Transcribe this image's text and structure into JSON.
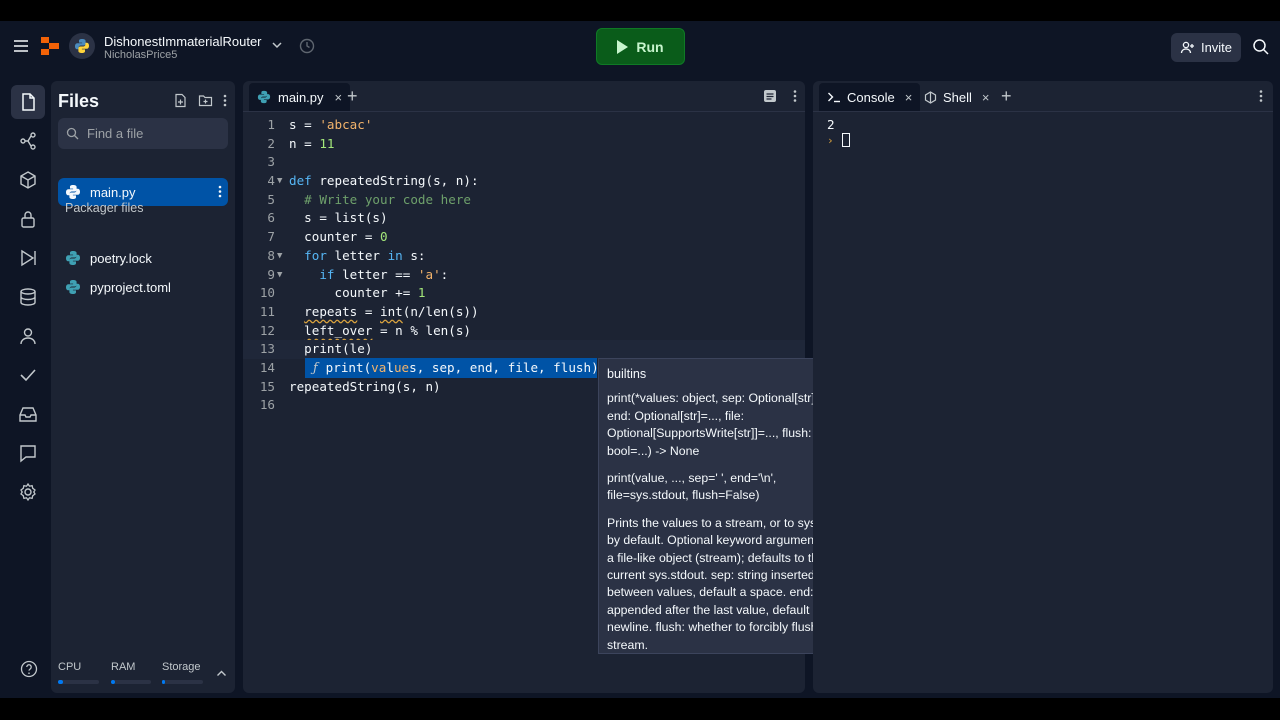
{
  "header": {
    "repl_name": "DishonestImmaterialRouter",
    "owner": "NicholasPrice5",
    "run_label": "Run",
    "invite_label": "Invite"
  },
  "rail": {
    "items": [
      "files-icon",
      "git-icon",
      "packages-icon",
      "secrets-icon",
      "debugger-icon",
      "database-icon",
      "user-icon",
      "check-icon",
      "inbox-icon",
      "chat-icon",
      "settings-icon"
    ]
  },
  "files": {
    "title": "Files",
    "search_placeholder": "Find a file",
    "items": [
      {
        "name": "main.py"
      }
    ],
    "packager_label": "Packager files",
    "packager_items": [
      {
        "name": "poetry.lock"
      },
      {
        "name": "pyproject.toml"
      }
    ],
    "stats": [
      {
        "label": "CPU",
        "fill": 0.12
      },
      {
        "label": "RAM",
        "fill": 0.1
      },
      {
        "label": "Storage",
        "fill": 0.08
      }
    ]
  },
  "editor": {
    "tab_label": "main.py",
    "tab_close": "×",
    "line_numbers": [
      "1",
      "2",
      "3",
      "4",
      "5",
      "6",
      "7",
      "8",
      "9",
      "10",
      "11",
      "12",
      "13",
      "14",
      "15",
      "16"
    ],
    "suggestion": {
      "icon": "ƒ",
      "text_a": "print(",
      "text_b": "va",
      "text_c": "l",
      "text_d": "u",
      "text_e": "e",
      "text_f": "s, sep, end, file, flush)"
    },
    "doc": {
      "header": "builtins",
      "sig": "print(*values: object, sep: Optional[str]=..., end: Optional[str]=..., file: Optional[SupportsWrite[str]]=..., flush: bool=...) -> None",
      "sig2": "print(value, ..., sep=' ', end='\\n', file=sys.stdout, flush=False)",
      "body": "Prints the values to a stream, or to sys.stdout by default. Optional keyword arguments: file:  a file-like object (stream); defaults to the current sys.stdout. sep:   string inserted between values, default a space. end:   string appended after the last value, default a newline. flush: whether to forcibly flush the stream."
    }
  },
  "console": {
    "tabs": [
      {
        "label": "Console",
        "close": "×"
      },
      {
        "label": "Shell",
        "close": "×"
      }
    ],
    "output": "2",
    "prompt": "›"
  }
}
